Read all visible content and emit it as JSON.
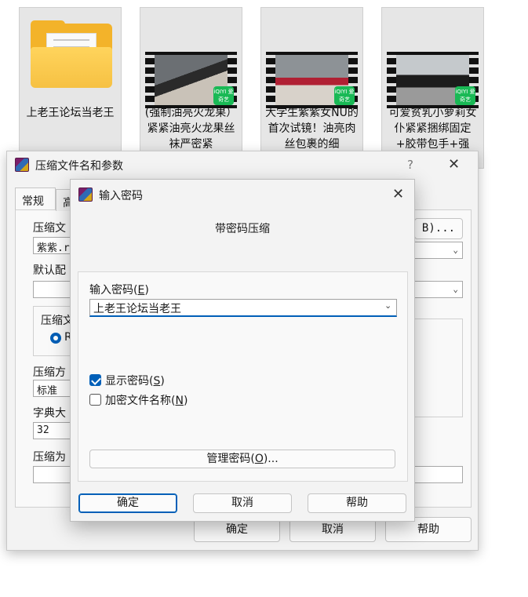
{
  "files": [
    {
      "type": "folder",
      "caption": "上老王论坛当老王"
    },
    {
      "type": "video",
      "caption": "(强制油亮火龙果）紧紧油亮火龙果丝袜严密紧",
      "badge": "iQIYI 爱奇艺"
    },
    {
      "type": "video",
      "caption": "大学生紫紫女NU的首次试镜！油亮肉丝包裹的细",
      "badge": "iQIYI 爱奇艺"
    },
    {
      "type": "video",
      "caption": "可爱贫乳小萝莉女仆紧紧捆绑固定+胶带包手+强",
      "badge": "iQIYI 爱奇艺"
    }
  ],
  "back_dialog": {
    "title": "压缩文件名和参数",
    "help_glyph": "?",
    "close_glyph": "✕",
    "tabs": [
      "常规",
      "高"
    ],
    "archive_name_label": "压缩文",
    "archive_name_value": "紫紫.r",
    "browse_suffix": "B)...",
    "default_profile_label": "默认配",
    "archive_format_label": "压缩文",
    "radio_label": "R",
    "method_label": "压缩方",
    "method_value": "标准",
    "dict_label": "字典大",
    "dict_value": "32",
    "split_label": "压缩为",
    "ok_label": "确定",
    "cancel_label": "取消",
    "help_label": "帮助"
  },
  "password_dialog": {
    "title": "输入密码",
    "close_glyph": "✕",
    "subtitle": "带密码压缩",
    "enter_label": "输入密码(",
    "enter_key": "E",
    "enter_label_end": ")",
    "password_value": "上老王论坛当老王",
    "show_password_label": "显示密码(",
    "show_password_key": "S",
    "show_password_end": ")",
    "show_password_checked": true,
    "encrypt_names_label": "加密文件名称(",
    "encrypt_names_key": "N",
    "encrypt_names_end": ")",
    "encrypt_names_checked": false,
    "manage_label": "管理密码(",
    "manage_key": "O",
    "manage_end": ")...",
    "ok_label": "确定",
    "cancel_label": "取消",
    "help_label": "帮助"
  },
  "colors": {
    "accent": "#005fb8",
    "folder": "#f3b32a",
    "badge": "#19b955"
  }
}
